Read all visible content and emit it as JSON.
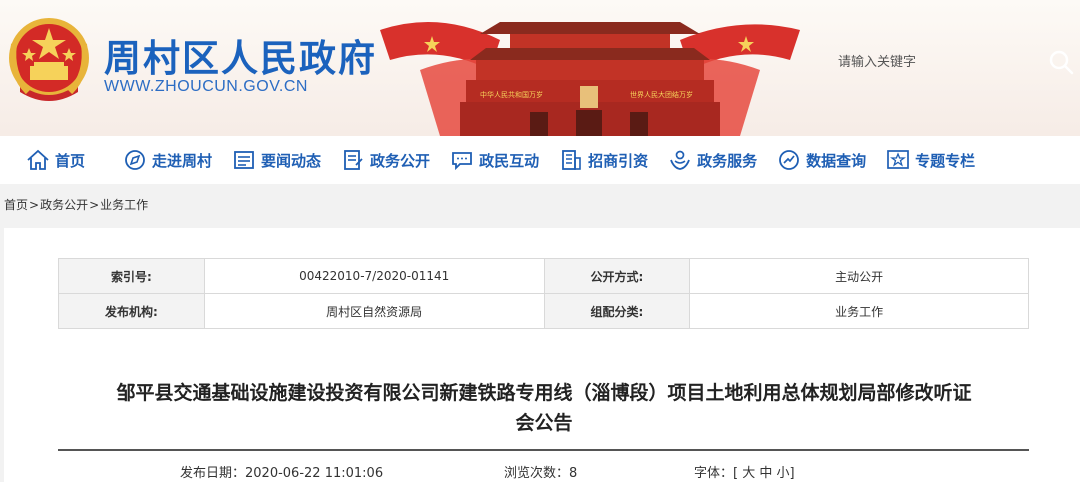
{
  "header": {
    "site_title": "周村区人民政府",
    "site_url": "WWW.ZHOUCUN.GOV.CN",
    "search_placeholder": "请输入关键字",
    "banner_slogan_left": "中华人民共和国万岁",
    "banner_slogan_right": "世界人民大团结万岁"
  },
  "nav": {
    "items": [
      {
        "label": "首页",
        "icon": "home-icon"
      },
      {
        "label": "走进周村",
        "icon": "compass-icon"
      },
      {
        "label": "要闻动态",
        "icon": "newspaper-icon"
      },
      {
        "label": "政务公开",
        "icon": "document-icon"
      },
      {
        "label": "政民互动",
        "icon": "chat-icon"
      },
      {
        "label": "招商引资",
        "icon": "building-icon"
      },
      {
        "label": "政务服务",
        "icon": "hands-icon"
      },
      {
        "label": "数据查询",
        "icon": "magnifier-icon"
      },
      {
        "label": "专题专栏",
        "icon": "star-icon"
      }
    ]
  },
  "breadcrumb": {
    "home": "首页",
    "sep": ">",
    "level2": "政务公开",
    "level3": "业务工作"
  },
  "meta": {
    "index_label": "索引号:",
    "index_value": "00422010-7/2020-01141",
    "disclosure_label": "公开方式:",
    "disclosure_value": "主动公开",
    "publisher_label": "发布机构:",
    "publisher_value": "周村区自然资源局",
    "category_label": "组配分类:",
    "category_value": "业务工作"
  },
  "article": {
    "title_line1": "邹平县交通基础设施建设投资有限公司新建铁路专用线（淄博段）项目土地利用总体规划局部修改听证",
    "title_line2": "会公告",
    "date_label": "发布日期：",
    "date_value": "2020-06-22 11:01:06",
    "views_label": "浏览次数：",
    "views_value": "8",
    "font_label": "字体：[",
    "font_large": "大",
    "font_medium": "中",
    "font_small": "小",
    "font_close": "]"
  },
  "colors": {
    "brand_blue": "#1b62bd",
    "banner_red": "#d42a2a",
    "gold": "#e8b43a"
  }
}
